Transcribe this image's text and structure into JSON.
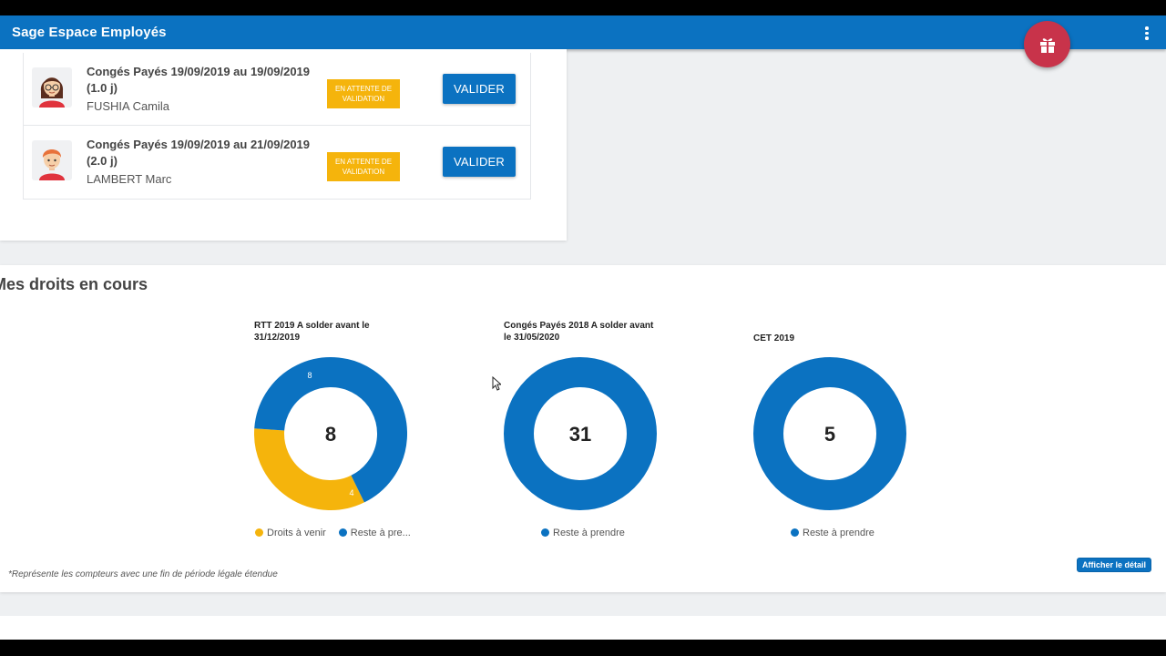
{
  "app": {
    "title": "Sage Espace Employés"
  },
  "colors": {
    "primary": "#0b72c1",
    "warning": "#f5b40c",
    "fab": "#c8334a"
  },
  "icons": {
    "fab": "gift-icon",
    "menu": "more-vertical-icon"
  },
  "requests": [
    {
      "title": "Congés Payés 19/09/2019 au 19/09/2019 (1.0 j)",
      "employee": "FUSHIA Camila",
      "status": "EN ATTENTE DE VALIDATION",
      "action": "VALIDER",
      "avatar": "female-avatar-icon"
    },
    {
      "title": "Congés Payés 19/09/2019 au 21/09/2019 (2.0 j)",
      "employee": "LAMBERT Marc",
      "status": "EN ATTENTE DE VALIDATION",
      "action": "VALIDER",
      "avatar": "male-avatar-icon"
    }
  ],
  "rights": {
    "title": "Mes droits en cours",
    "footnote": "*Représente les compteurs avec une fin de période légale étendue",
    "detail_button": "Afficher  le détail"
  },
  "chart_data": [
    {
      "type": "pie",
      "title": "RTT 2019 A solder avant le 31/12/2019",
      "center_value": "8",
      "series": [
        {
          "name": "Droits à venir",
          "value": 4,
          "value_label": "4",
          "color": "#f5b40c"
        },
        {
          "name": "Reste à pre...",
          "value": 8,
          "value_label": "8",
          "color": "#0b72c1"
        }
      ]
    },
    {
      "type": "pie",
      "title": "Congés Payés 2018 A solder avant le 31/05/2020",
      "center_value": "31",
      "series": [
        {
          "name": "Reste à prendre",
          "value": 31,
          "color": "#0b72c1"
        }
      ]
    },
    {
      "type": "pie",
      "title": "CET 2019",
      "center_value": "5",
      "series": [
        {
          "name": "Reste à prendre",
          "value": 5,
          "color": "#0b72c1"
        }
      ]
    }
  ]
}
